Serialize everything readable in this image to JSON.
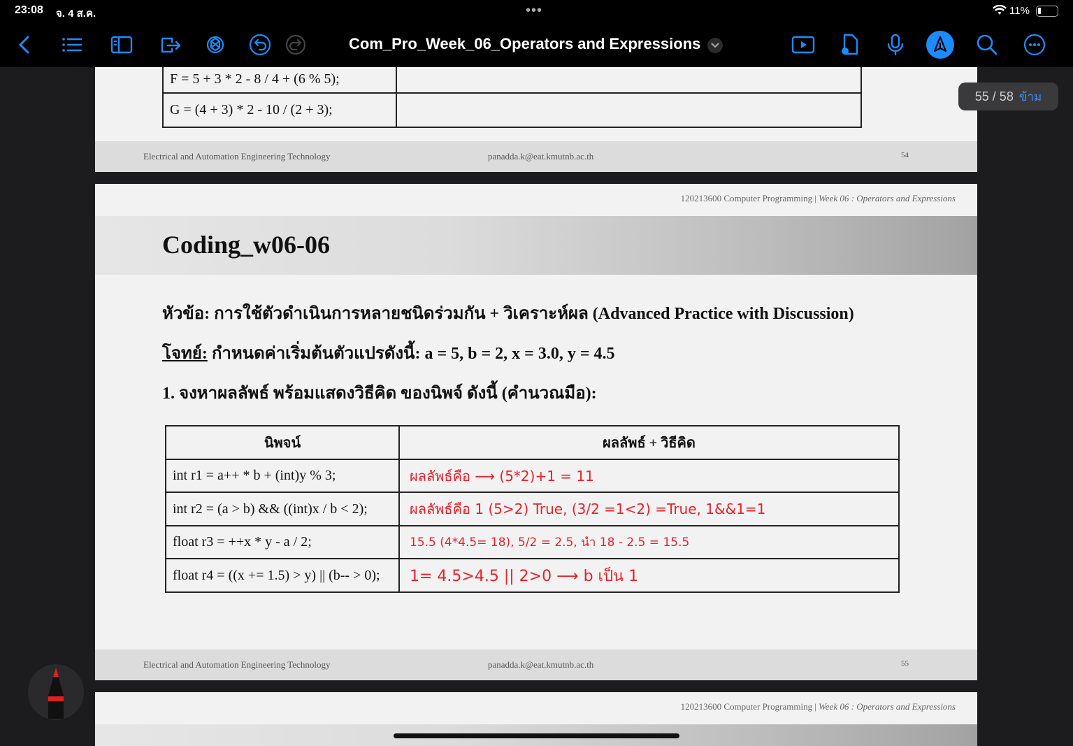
{
  "status_bar": {
    "time": "23:08",
    "date": "จ. 4 ส.ค.",
    "battery": "11%"
  },
  "toolbar": {
    "title": "Com_Pro_Week_06_Operators and Expressions"
  },
  "page_counter": {
    "text": "55 / 58",
    "jump_label": "ข้าม"
  },
  "page_54": {
    "rows": [
      {
        "expr": "F = 5 + 3 * 2 - 8 / 4 + (6 % 5);",
        "answer": ""
      },
      {
        "expr": "G = (4 + 3) * 2 - 10 / (2 + 3);",
        "answer": ""
      }
    ],
    "footer_left": "Electrical and Automation Engineering Technology",
    "footer_center": "panadda.k@eat.kmutnb.ac.th",
    "footer_page": "54"
  },
  "page_55": {
    "header_course": "120213600 Computer Programming | ",
    "header_week": "Week 06 : Operators and Expressions",
    "title": "Coding_w06-06",
    "topic": "หัวข้อ: การใช้ตัวดำเนินการหลายชนิดร่วมกัน + วิเคราะห์ผล (Advanced Practice with Discussion)",
    "task_label": "โจทย์:",
    "task_text": " กำหนดค่าเริ่มต้นตัวแปรดังนี้: a = 5, b = 2, x = 3.0, y = 4.5",
    "question": "1. จงหาผลลัพธ์ พร้อมแสดงวิธีคิด ของนิพจ์ ดังนี้ (คำนวณมือ):",
    "table_headers": [
      "นิพจน์",
      "ผลลัพธ์ + วิธีคิด"
    ],
    "rows": [
      {
        "expr": "int r1 = a++ * b + (int)y % 3;",
        "answer": "ผลลัพธ์คือ ⟶ (5*2)+1 = 11"
      },
      {
        "expr": "int r2 = (a > b) && ((int)x / b < 2);",
        "answer": "ผลลัพธ์คือ 1 (5>2) True, (3/2 =1<2) =True, 1&&1=1"
      },
      {
        "expr": "float r3 = ++x * y - a / 2;",
        "answer": "15.5   (4*4.5= 18), 5/2 = 2.5, นำ 18 - 2.5 = 15.5"
      },
      {
        "expr": "float r4 = ((x += 1.5) > y) || (b-- > 0);",
        "answer": "1= 4.5>4.5 || 2>0 ⟶ b เป็น 1"
      }
    ],
    "footer_left": "Electrical and Automation Engineering Technology",
    "footer_center": "panadda.k@eat.kmutnb.ac.th",
    "footer_page": "55"
  },
  "page_56": {
    "header_course": "120213600 Computer Programming | ",
    "header_week": "Week 06 : Operators and Expressions"
  }
}
